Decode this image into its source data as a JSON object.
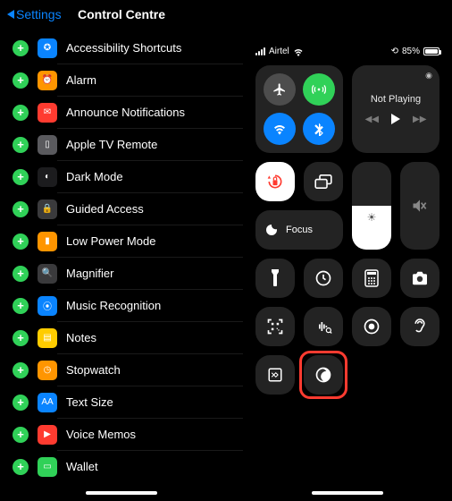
{
  "header": {
    "back_label": "Settings",
    "title": "Control Centre"
  },
  "items": [
    {
      "label": "Accessibility Shortcuts",
      "icon_bg": "#0a84ff",
      "icon_name": "accessibility-icon",
      "glyph": "✪"
    },
    {
      "label": "Alarm",
      "icon_bg": "#ff9500",
      "icon_name": "alarm-icon",
      "glyph": "⏰"
    },
    {
      "label": "Announce Notifications",
      "icon_bg": "#ff3b30",
      "icon_name": "announce-icon",
      "glyph": "✉"
    },
    {
      "label": "Apple TV Remote",
      "icon_bg": "#5a5a5e",
      "icon_name": "tv-remote-icon",
      "glyph": "▯"
    },
    {
      "label": "Dark Mode",
      "icon_bg": "#1c1c1e",
      "icon_name": "dark-mode-icon",
      "glyph": "◐"
    },
    {
      "label": "Guided Access",
      "icon_bg": "#3a3a3c",
      "icon_name": "guided-access-icon",
      "glyph": "🔒"
    },
    {
      "label": "Low Power Mode",
      "icon_bg": "#ff9500",
      "icon_name": "low-power-icon",
      "glyph": "▮"
    },
    {
      "label": "Magnifier",
      "icon_bg": "#3a3a3c",
      "icon_name": "magnifier-icon",
      "glyph": "🔍"
    },
    {
      "label": "Music Recognition",
      "icon_bg": "#0a84ff",
      "icon_name": "shazam-icon",
      "glyph": "⦿"
    },
    {
      "label": "Notes",
      "icon_bg": "#ffcc00",
      "icon_name": "notes-icon",
      "glyph": "▤"
    },
    {
      "label": "Stopwatch",
      "icon_bg": "#ff9500",
      "icon_name": "stopwatch-icon",
      "glyph": "◷"
    },
    {
      "label": "Text Size",
      "icon_bg": "#0a84ff",
      "icon_name": "text-size-icon",
      "glyph": "AA"
    },
    {
      "label": "Voice Memos",
      "icon_bg": "#ff3b30",
      "icon_name": "voice-memos-icon",
      "glyph": "▶"
    },
    {
      "label": "Wallet",
      "icon_bg": "#30d158",
      "icon_name": "wallet-icon",
      "glyph": "▭"
    }
  ],
  "cc": {
    "carrier": "Airtel",
    "battery_pct": "85%",
    "now_playing": "Not Playing",
    "focus_label": "Focus",
    "brightness_pct": 50,
    "volume_pct": 0
  }
}
